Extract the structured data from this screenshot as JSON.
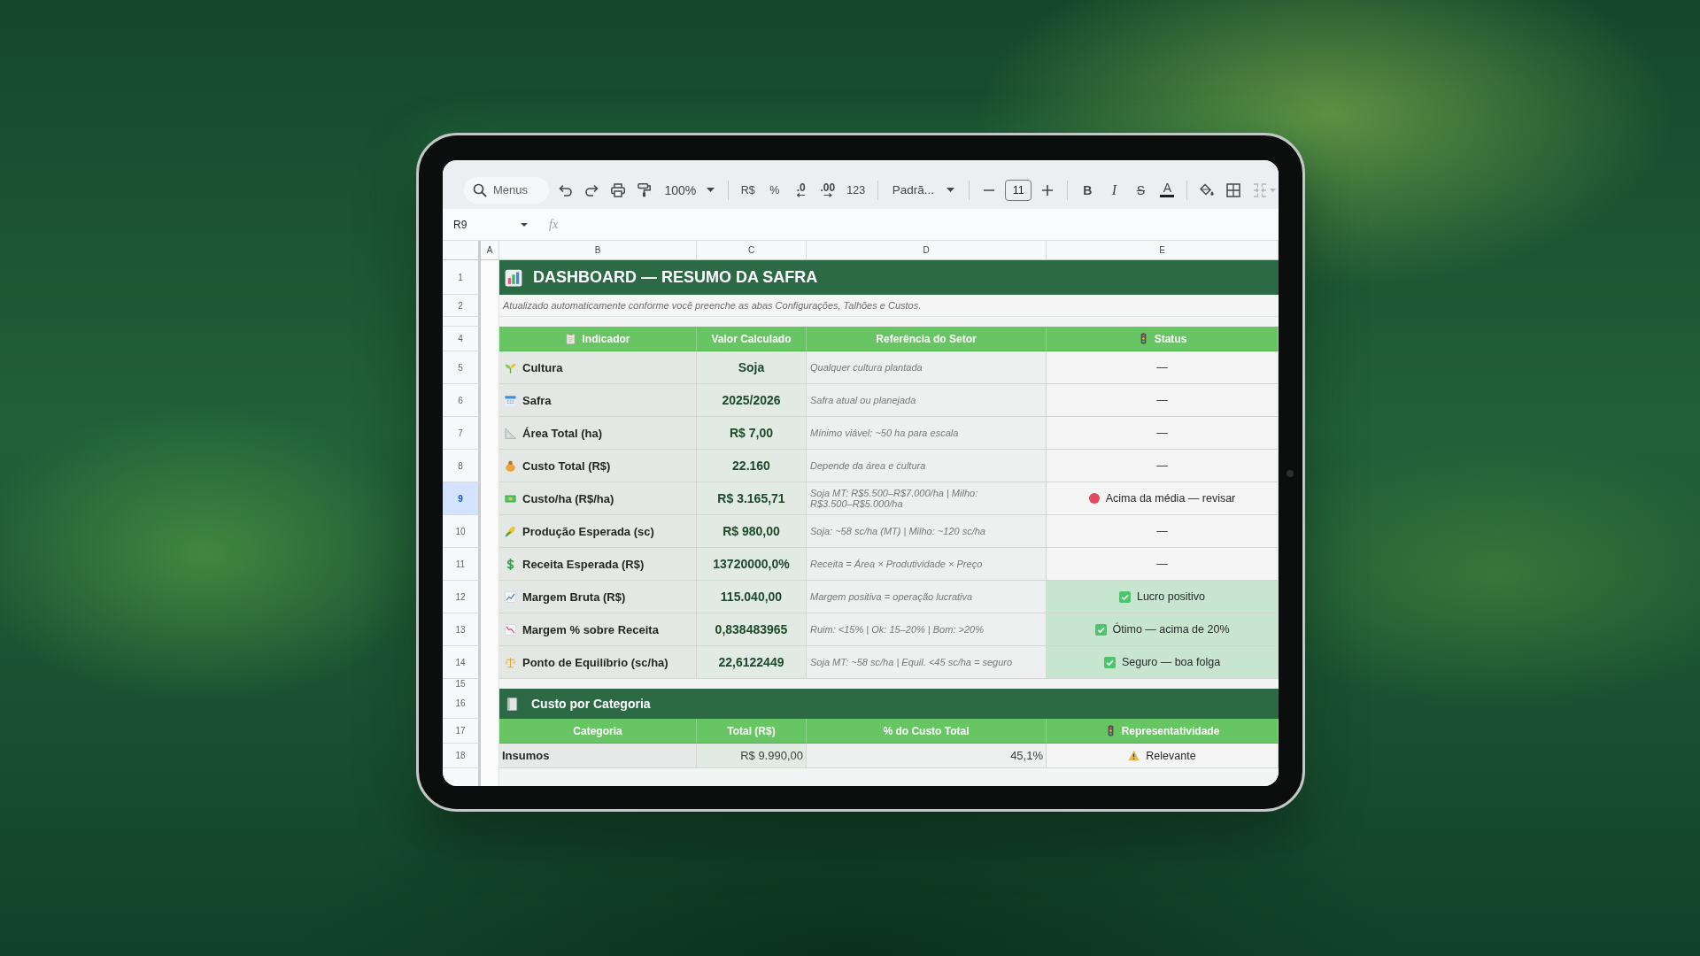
{
  "toolbar": {
    "search": {
      "placeholder": "Menus"
    },
    "zoom": "100%",
    "format_buttons": [
      {
        "kind": "text",
        "label": "R$"
      },
      {
        "kind": "text",
        "label": "%"
      },
      {
        "kind": "decimal_less",
        "label": ".0"
      },
      {
        "kind": "decimal_more",
        "label": ".00"
      },
      {
        "kind": "text",
        "label": "123"
      }
    ],
    "font": "Padrã...",
    "font_size": "11",
    "style_buttons": [
      {
        "kind": "bold",
        "label": "B"
      },
      {
        "kind": "italic",
        "label": "I"
      },
      {
        "kind": "strike",
        "label": "S"
      },
      {
        "kind": "color",
        "label": "A"
      }
    ]
  },
  "formula_bar": {
    "cell": "R9",
    "function_label": "fx"
  },
  "sheet": {
    "columns": [
      "A",
      "B",
      "C",
      "D",
      "E"
    ],
    "rows": [
      {
        "kind": "title",
        "number": "1",
        "selected": false,
        "text": "DASHBOARD — RESUMO DA SAFRA"
      },
      {
        "kind": "note",
        "number": "2",
        "selected": false,
        "text": "Atualizado automaticamente conforme você preenche as abas Configurações, Talhões e Custos."
      },
      {
        "kind": "gap"
      },
      {
        "kind": "header",
        "number": "4",
        "selected": false,
        "cells": [
          "Indicador",
          "Valor Calculado",
          "Referência do Setor",
          "Status"
        ]
      },
      {
        "kind": "indicator",
        "number": "5",
        "selected": false,
        "label": "Cultura",
        "value": "Soja",
        "reference": "Qualquer cultura plantada",
        "status": {
          "kind": "none",
          "text": "—"
        }
      },
      {
        "kind": "indicator",
        "number": "6",
        "selected": false,
        "label": "Safra",
        "value": "2025/2026",
        "reference": "Safra atual ou planejada",
        "status": {
          "kind": "none",
          "text": "—"
        }
      },
      {
        "kind": "indicator",
        "number": "7",
        "selected": false,
        "label": "Área Total (ha)",
        "value": "R$ 7,00",
        "reference": "Mínimo viável: ~50 ha para escala",
        "status": {
          "kind": "none",
          "text": "—"
        }
      },
      {
        "kind": "indicator",
        "number": "8",
        "selected": false,
        "label": "Custo Total (R$)",
        "value": "22.160",
        "reference": "Depende da área e cultura",
        "status": {
          "kind": "none",
          "text": "—"
        }
      },
      {
        "kind": "indicator",
        "number": "9",
        "selected": true,
        "label": "Custo/ha (R$/ha)",
        "value": "R$ 3.165,71",
        "reference": "Soja MT: R$5.500–R$7.000/ha | Milho: R$3.500–R$5.000/ha",
        "status": {
          "kind": "alert",
          "text": "Acima da média — revisar"
        }
      },
      {
        "kind": "indicator",
        "number": "10",
        "selected": false,
        "label": "Produção Esperada (sc)",
        "value": "R$ 980,00",
        "reference": "Soja: ~58 sc/ha (MT) | Milho: ~120 sc/ha",
        "status": {
          "kind": "none",
          "text": "—"
        }
      },
      {
        "kind": "indicator",
        "number": "11",
        "selected": false,
        "label": "Receita Esperada (R$)",
        "value": "13720000,0%",
        "reference": "Receita = Área × Produtividade × Preço",
        "status": {
          "kind": "none",
          "text": "—"
        }
      },
      {
        "kind": "indicator",
        "number": "12",
        "selected": false,
        "label": "Margem Bruta (R$)",
        "value": "115.040,00",
        "reference": "Margem positiva = operação lucrativa",
        "status": {
          "kind": "check",
          "text": "Lucro positivo"
        }
      },
      {
        "kind": "indicator",
        "number": "13",
        "selected": false,
        "label": "Margem % sobre Receita",
        "value": "0,838483965",
        "reference": "Ruim: <15% | Ok: 15–20% | Bom: >20%",
        "status": {
          "kind": "check",
          "text": "Ótimo — acima de 20%"
        }
      },
      {
        "kind": "indicator",
        "number": "14",
        "selected": false,
        "label": "Ponto de Equilíbrio (sc/ha)",
        "value": "22,6122449",
        "reference": "Soja MT: ~58 sc/ha | Equil. <45 sc/ha = seguro",
        "status": {
          "kind": "check",
          "text": "Seguro — boa folga"
        }
      },
      {
        "kind": "gap",
        "number": "15",
        "selected": false
      },
      {
        "kind": "section",
        "number": "16",
        "selected": false,
        "text": "Custo por Categoria"
      },
      {
        "kind": "header",
        "number": "17",
        "selected": false,
        "cells": [
          "Categoria",
          "Total (R$)",
          "% do Custo Total",
          "Representatividade"
        ]
      },
      {
        "kind": "category",
        "number": "18",
        "selected": false,
        "category": "Insumos",
        "total": "R$ 9.990,00",
        "share": "45,1%",
        "status": {
          "kind": "warning",
          "text": "Relevante"
        }
      }
    ]
  }
}
